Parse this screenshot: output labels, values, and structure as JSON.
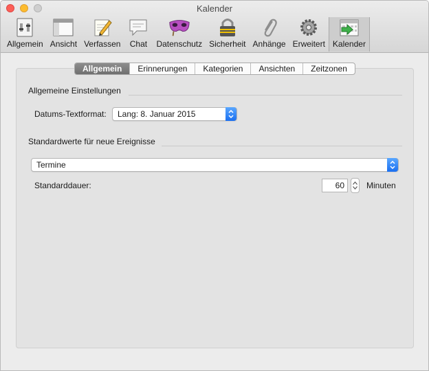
{
  "window": {
    "title": "Kalender"
  },
  "toolbar": {
    "items": [
      {
        "label": "Allgemein",
        "icon": "switch-icon"
      },
      {
        "label": "Ansicht",
        "icon": "window-icon"
      },
      {
        "label": "Verfassen",
        "icon": "pencil-paper-icon"
      },
      {
        "label": "Chat",
        "icon": "speech-bubble-icon"
      },
      {
        "label": "Datenschutz",
        "icon": "mask-icon"
      },
      {
        "label": "Sicherheit",
        "icon": "lock-icon"
      },
      {
        "label": "Anhänge",
        "icon": "paperclip-icon"
      },
      {
        "label": "Erweitert",
        "icon": "gear-icon"
      },
      {
        "label": "Kalender",
        "icon": "calendar-icon"
      }
    ],
    "selected": "Kalender"
  },
  "tabs": [
    "Allgemein",
    "Erinnerungen",
    "Kategorien",
    "Ansichten",
    "Zeitzonen"
  ],
  "active_tab": "Allgemein",
  "general": {
    "title": "Allgemeine Einstellungen",
    "date_format_label": "Datums-Textformat:",
    "date_format_value": "Lang: 8. Januar 2015"
  },
  "defaults": {
    "title": "Standardwerte für neue Ereignisse",
    "type_value": "Termine",
    "duration_label": "Standarddauer:",
    "duration_value": "60",
    "duration_unit": "Minuten"
  },
  "colors": {
    "accent": "#2a7af5",
    "close": "#fc5f57",
    "minimize": "#fdbc2e"
  }
}
